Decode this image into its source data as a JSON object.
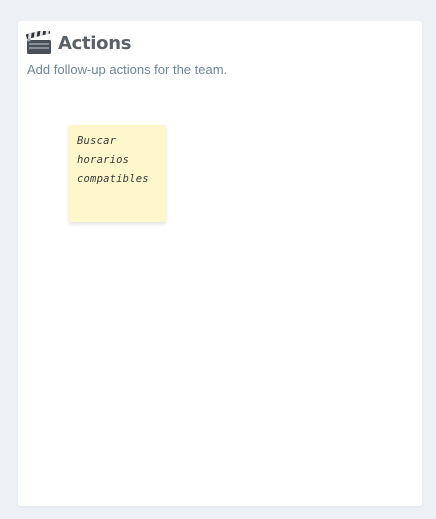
{
  "panel": {
    "icon": "clapperboard-icon",
    "title": "Actions",
    "subtitle": "Add follow-up actions for the team."
  },
  "notes": [
    {
      "text": "Buscar\nhorarios\ncompatibles",
      "color": "#fff7cc"
    }
  ],
  "colors": {
    "background": "#edf1f5",
    "panel": "#ffffff",
    "title": "#5b6168",
    "subtitle": "#6f8694",
    "sticky": "#fff7cc"
  }
}
